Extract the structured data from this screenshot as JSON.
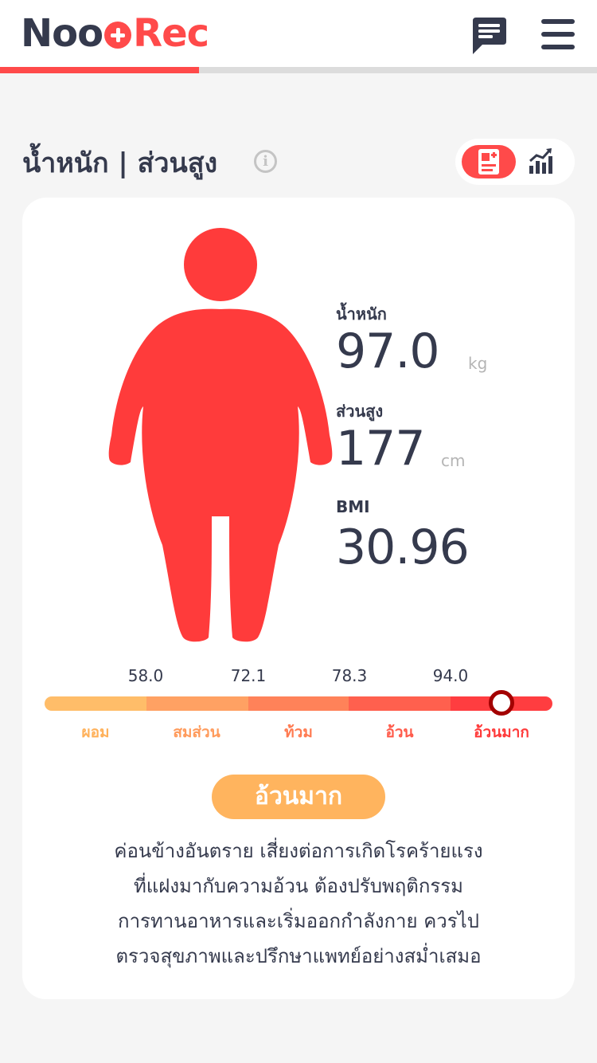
{
  "header": {
    "logo_left": "Noo",
    "logo_right": "Rec",
    "logo_icon": "plus-circle-icon",
    "chat_icon": "chat-bubble-icon",
    "menu_icon": "hamburger-menu-icon",
    "progress_fraction": 0.333
  },
  "section": {
    "title": "น้ำหนัก | ส่วนสูง",
    "info_glyph": "i",
    "toggle": {
      "active": "report",
      "report_icon": "report-icon",
      "chart_icon": "bar-chart-icon"
    }
  },
  "stats": {
    "weight": {
      "label": "น้ำหนัก",
      "value": "97.0",
      "unit": "kg"
    },
    "height": {
      "label": "ส่วนสูง",
      "value": "177",
      "unit": "cm"
    },
    "bmi": {
      "label": "BMI",
      "value": "30.96"
    }
  },
  "scale": {
    "thresholds": [
      "58.0",
      "72.1",
      "78.3",
      "94.0"
    ],
    "categories": [
      {
        "label": "ผอม",
        "color": "#ffbd69",
        "text_color": "#ffb15a"
      },
      {
        "label": "สมส่วน",
        "color": "#ffa163",
        "text_color": "#ff9b5c"
      },
      {
        "label": "ท้วม",
        "color": "#ff8259",
        "text_color": "#ff7a50"
      },
      {
        "label": "อ้วน",
        "color": "#ff604e",
        "text_color": "#ff5a4a"
      },
      {
        "label": "อ้วนมาก",
        "color": "#ff3d40",
        "text_color": "#ff3a3a"
      }
    ],
    "current_value": 97.0,
    "current_category_index": 4
  },
  "status": {
    "label": "อ้วนมาก",
    "color": "#ffb45e"
  },
  "advice": {
    "lines": [
      "ค่อนข้างอันตราย เสี่ยงต่อการเกิดโรคร้ายแรง",
      "ที่แฝงมากับความอ้วน ต้องปรับพฤติกรรม",
      "การทานอาหารและเริ่มออกกำลังกาย ควรไป",
      "ตรวจสุขภาพและปรึกษาแพทย์อย่างสม่ำเสมอ"
    ]
  },
  "colors": {
    "brand_dark": "#353a4d",
    "brand_red": "#ff4a4a",
    "figure": "#ff3b3b",
    "marker_ring": "#a30000"
  }
}
